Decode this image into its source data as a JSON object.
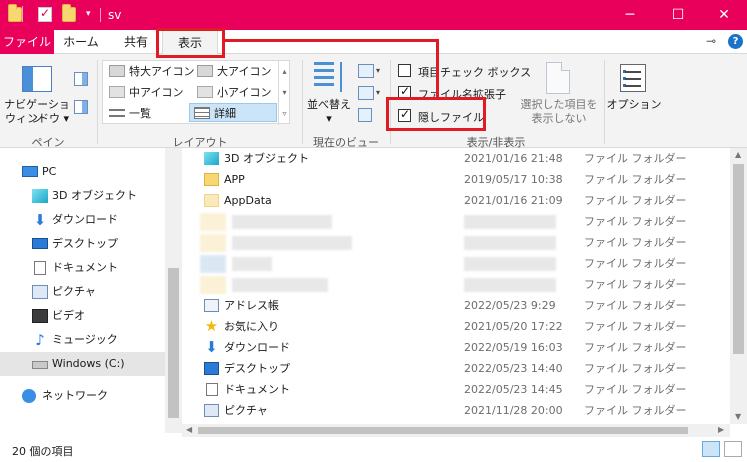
{
  "window": {
    "title": "sv",
    "minimize": "─",
    "maximize": "☐",
    "close": "✕"
  },
  "tabs": {
    "file": "ファイル",
    "home": "ホーム",
    "share": "共有",
    "view": "表示"
  },
  "ribbon": {
    "pane": {
      "nav_pane_line1": "ナビゲーション",
      "nav_pane_line2": "ウィンドウ ▾",
      "group_label": "ペイン"
    },
    "layout": {
      "items": [
        "特大アイコン",
        "大アイコン",
        "中アイコン",
        "小アイコン",
        "一覧",
        "詳細"
      ],
      "selected": "詳細",
      "group_label": "レイアウト"
    },
    "current_view": {
      "sort_label": "並べ替え",
      "group_label": "現在のビュー"
    },
    "show_hide": {
      "item_checkbox": {
        "label": "項目チェック ボックス",
        "checked": false
      },
      "extensions": {
        "label": "ファイル名拡張子",
        "checked": true
      },
      "hidden_files": {
        "label": "隠しファイル",
        "checked": true
      },
      "hide_selected_line1": "選択した項目を",
      "hide_selected_line2": "表示しない",
      "group_label": "表示/非表示"
    },
    "options_label": "オプション"
  },
  "nav": {
    "items": [
      {
        "label": "PC",
        "icon": "pc-icon"
      },
      {
        "label": "3D オブジェクト",
        "icon": "3d-objects-icon"
      },
      {
        "label": "ダウンロード",
        "icon": "download-icon"
      },
      {
        "label": "デスクトップ",
        "icon": "desktop-icon"
      },
      {
        "label": "ドキュメント",
        "icon": "document-icon"
      },
      {
        "label": "ピクチャ",
        "icon": "pictures-icon"
      },
      {
        "label": "ビデオ",
        "icon": "video-icon"
      },
      {
        "label": "ミュージック",
        "icon": "music-icon"
      },
      {
        "label": "Windows (C:)",
        "icon": "drive-icon",
        "selected": true
      },
      {
        "label": "ネットワーク",
        "icon": "network-icon"
      }
    ]
  },
  "files": [
    {
      "name": "3D オブジェクト",
      "date": "2021/01/16 21:48",
      "type": "ファイル フォルダー",
      "icon": "3d-objects-icon"
    },
    {
      "name": "APP",
      "date": "2019/05/17 10:38",
      "type": "ファイル フォルダー",
      "icon": "folder-icon"
    },
    {
      "name": "AppData",
      "date": "2021/01/16 21:09",
      "type": "ファイル フォルダー",
      "icon": "hidden-folder-icon"
    },
    {
      "name": "",
      "date": "",
      "type": "ファイル フォルダー",
      "icon": "blurred"
    },
    {
      "name": "",
      "date": "",
      "type": "ファイル フォルダー",
      "icon": "blurred"
    },
    {
      "name": "",
      "date": "",
      "type": "ファイル フォルダー",
      "icon": "blurred"
    },
    {
      "name": "",
      "date": "",
      "type": "ファイル フォルダー",
      "icon": "blurred"
    },
    {
      "name": "アドレス帳",
      "date": "2022/05/23 9:29",
      "type": "ファイル フォルダー",
      "icon": "contacts-icon"
    },
    {
      "name": "お気に入り",
      "date": "2021/05/20 17:22",
      "type": "ファイル フォルダー",
      "icon": "star-icon"
    },
    {
      "name": "ダウンロード",
      "date": "2022/05/19 16:03",
      "type": "ファイル フォルダー",
      "icon": "download-icon"
    },
    {
      "name": "デスクトップ",
      "date": "2022/05/23 14:40",
      "type": "ファイル フォルダー",
      "icon": "desktop-icon"
    },
    {
      "name": "ドキュメント",
      "date": "2022/05/23 14:45",
      "type": "ファイル フォルダー",
      "icon": "document-icon"
    },
    {
      "name": "ピクチャ",
      "date": "2021/11/28 20:00",
      "type": "ファイル フォルダー",
      "icon": "pictures-icon"
    }
  ],
  "status": {
    "count": "20 個の項目"
  },
  "colors": {
    "accent": "#e8005a",
    "annotation": "#e01b24",
    "selection": "#cce4f7"
  }
}
